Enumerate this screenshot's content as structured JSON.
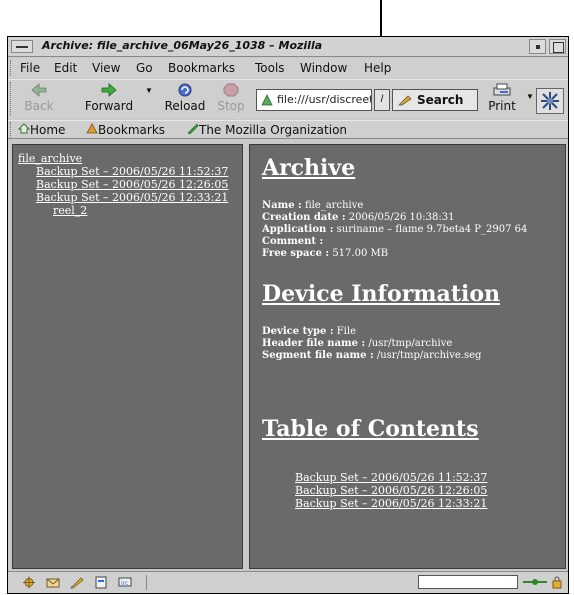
{
  "window": {
    "title": "Archive: file_archive_06May26_1038 – Mozilla"
  },
  "menubar": [
    "File",
    "Edit",
    "View",
    "Go",
    "Bookmarks",
    "Tools",
    "Window",
    "Help"
  ],
  "toolbar": {
    "back": "Back",
    "forward": "Forward",
    "reload": "Reload",
    "stop": "Stop",
    "url": "file:///usr/discreet",
    "search": "Search",
    "print": "Print"
  },
  "personal_toolbar": {
    "home": "Home",
    "bookmarks": "Bookmarks",
    "mozilla_org": "The Mozilla Organization"
  },
  "tree": {
    "root": "file_archive",
    "backup_sets": [
      "Backup Set – 2006/05/26 11:52:37",
      "Backup Set – 2006/05/26 12:26:05",
      "Backup Set – 2006/05/26 12:33:21"
    ],
    "reel": "reel_2"
  },
  "archive": {
    "heading": "Archive",
    "name_label": "Name :",
    "name": "file_archive",
    "creation_label": "Creation date :",
    "creation": "2006/05/26 10:38:31",
    "application_label": "Application :",
    "application": "suriname – flame 9.7beta4 P_2907 64",
    "comment_label": "Comment :",
    "comment": "",
    "free_label": "Free space :",
    "free": "517.00 MB"
  },
  "device": {
    "heading": "Device Information",
    "type_label": "Device type :",
    "type": "File",
    "header_label": "Header file name :",
    "header": "/usr/tmp/archive",
    "segment_label": "Segment file name :",
    "segment": "/usr/tmp/archive.seg"
  },
  "toc": {
    "heading": "Table of Contents",
    "items": [
      "Backup Set – 2006/05/26 11:52:37",
      "Backup Set – 2006/05/26 12:26:05",
      "Backup Set – 2006/05/26 12:33:21"
    ]
  },
  "colors": {
    "content_bg": "#6a6a6a",
    "chrome_bg": "#cfcfcf",
    "link": "#ffffff"
  }
}
